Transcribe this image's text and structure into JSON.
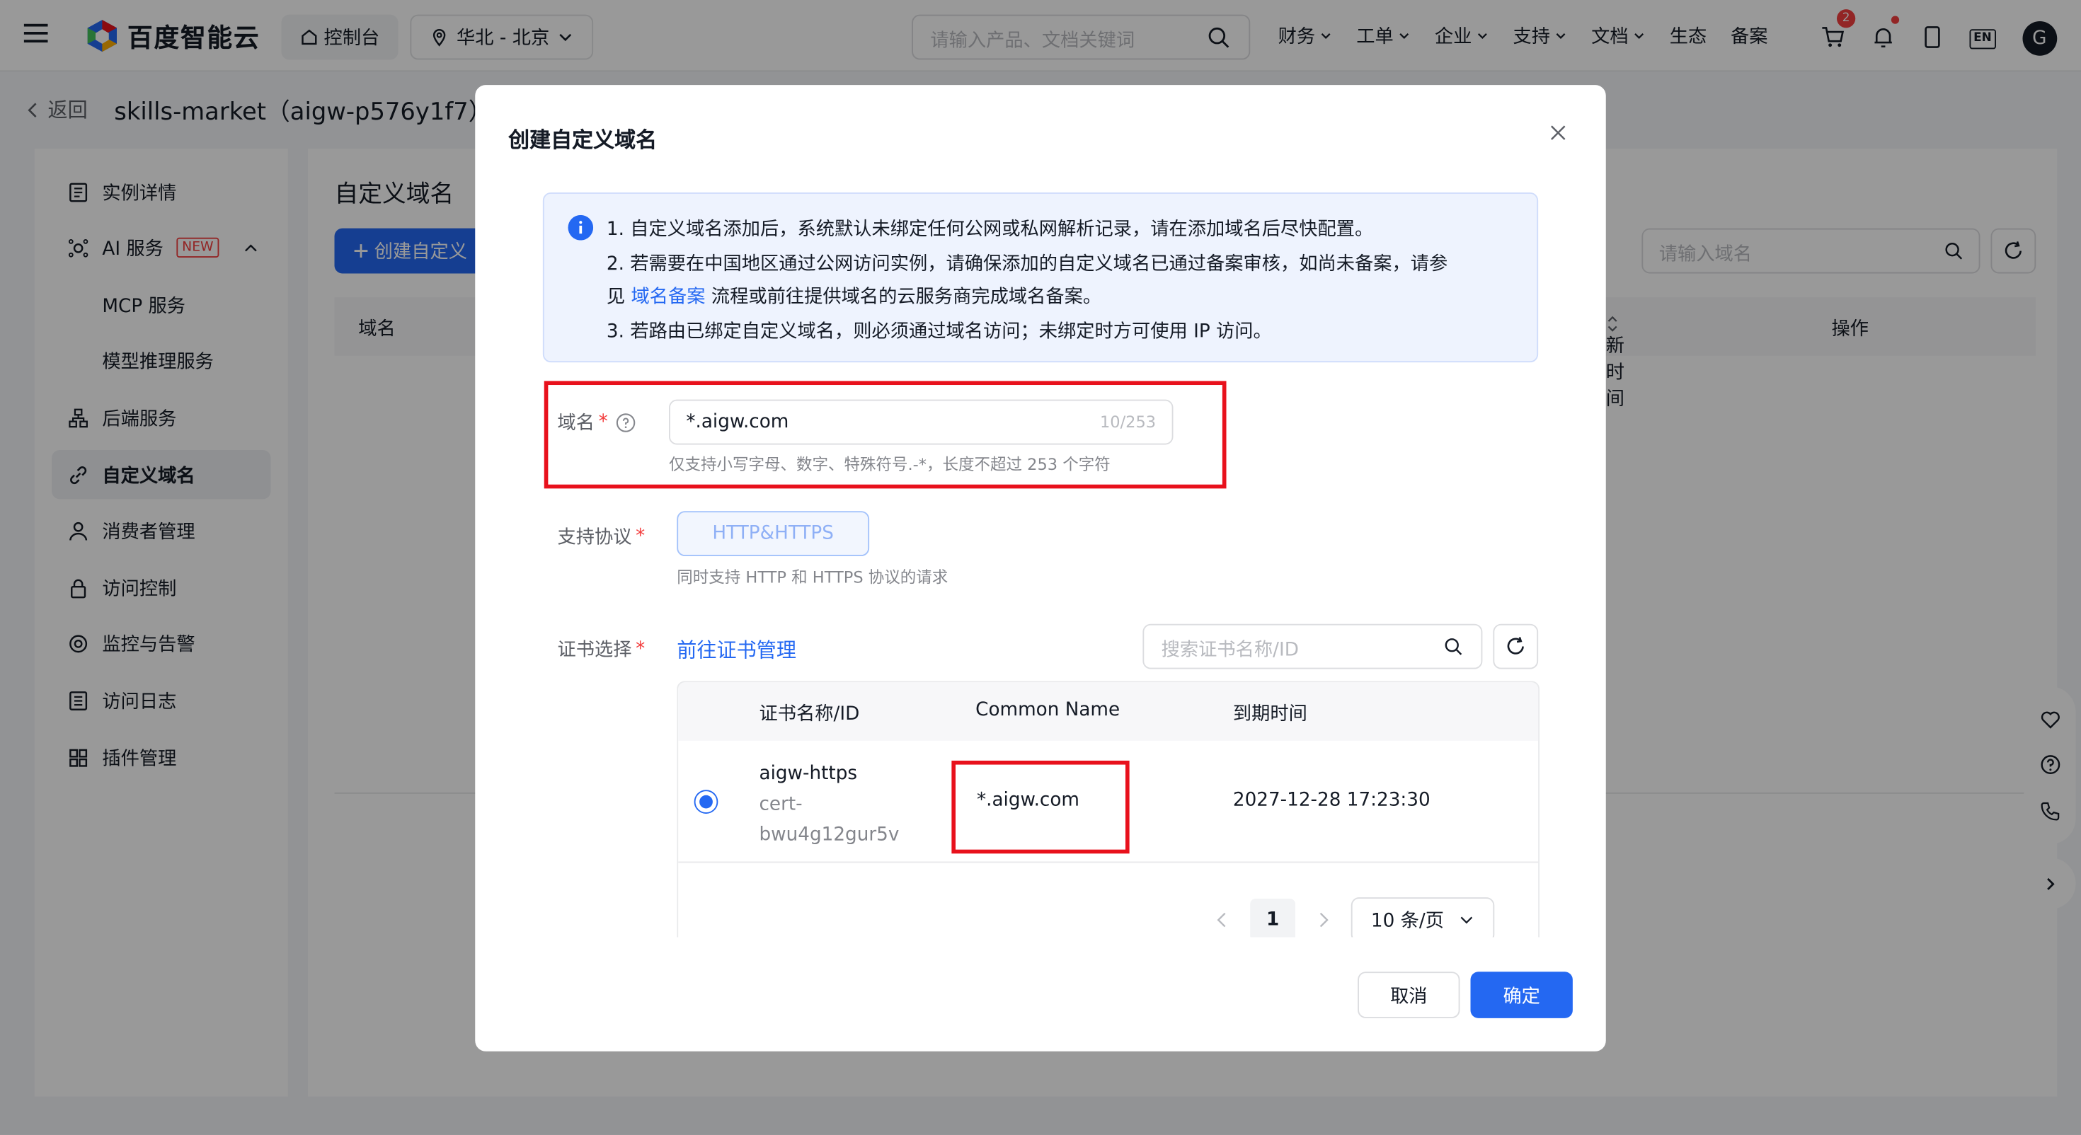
{
  "topbar": {
    "brand": "百度智能云",
    "console": "控制台",
    "region": "华北 - 北京",
    "search_placeholder": "请输入产品、文档关键词",
    "nav": [
      "财务",
      "工单",
      "企业",
      "支持",
      "文档",
      "生态",
      "备案"
    ],
    "cart_badge": "2",
    "lang": "EN",
    "avatar": "G"
  },
  "header": {
    "back": "返回",
    "instance_title": "skills-market（aigw-p576y1f7）"
  },
  "sidebar": {
    "items": [
      {
        "label": "实例详情",
        "icon": "document-icon"
      },
      {
        "label": "AI 服务",
        "icon": "ai-icon",
        "tag": "NEW"
      },
      {
        "label": "MCP 服务"
      },
      {
        "label": "模型推理服务"
      },
      {
        "label": "后端服务",
        "icon": "server-icon"
      },
      {
        "label": "自定义域名",
        "icon": "link-icon"
      },
      {
        "label": "消费者管理",
        "icon": "user-icon"
      },
      {
        "label": "访问控制",
        "icon": "lock-icon"
      },
      {
        "label": "监控与告警",
        "icon": "monitor-icon"
      },
      {
        "label": "访问日志",
        "icon": "log-icon"
      },
      {
        "label": "插件管理",
        "icon": "plugin-icon"
      }
    ]
  },
  "content": {
    "title": "自定义域名",
    "create_button": "创建自定义",
    "search_placeholder": "请输入域名",
    "columns": [
      "域名",
      "新时间",
      "操作"
    ]
  },
  "modal": {
    "title": "创建自定义域名",
    "info": {
      "line1": "1. 自定义域名添加后，系统默认未绑定任何公网或私网解析记录，请在添加域名后尽快配置。",
      "line2": "2. 若需要在中国地区通过公网访问实例，请确保添加的自定义域名已通过备案审核，如尚未备案，请参",
      "line3_pre": "见",
      "line3_link": "域名备案",
      "line3_post": "流程或前往提供域名的云服务商完成域名备案。",
      "line4": "3. 若路由已绑定自定义域名，则必须通过域名访问；未绑定时方可使用 IP 访问。"
    },
    "domain": {
      "label": "域名",
      "value": "*.aigw.com",
      "count": "10/253",
      "hint": "仅支持小写字母、数字、特殊符号.-*，长度不超过 253 个字符"
    },
    "protocol": {
      "label": "支持协议",
      "value": "HTTP&HTTPS",
      "hint": "同时支持 HTTP 和 HTTPS 协议的请求"
    },
    "cert": {
      "label": "证书选择",
      "manage_link": "前往证书管理",
      "search_placeholder": "搜索证书名称/ID",
      "columns": [
        "证书名称/ID",
        "Common Name",
        "到期时间"
      ],
      "rows": [
        {
          "name": "aigw-https",
          "id_line1": "cert-",
          "id_line2": "bwu4g12gur5v",
          "common_name": "*.aigw.com",
          "expire": "2027-12-28 17:23:30",
          "selected": true
        }
      ],
      "page": "1",
      "page_size": "10 条/页"
    },
    "cancel": "取消",
    "confirm": "确定"
  },
  "colors": {
    "primary": "#2468f2",
    "highlight_box": "#e8111c",
    "required": "#f33e3e"
  }
}
